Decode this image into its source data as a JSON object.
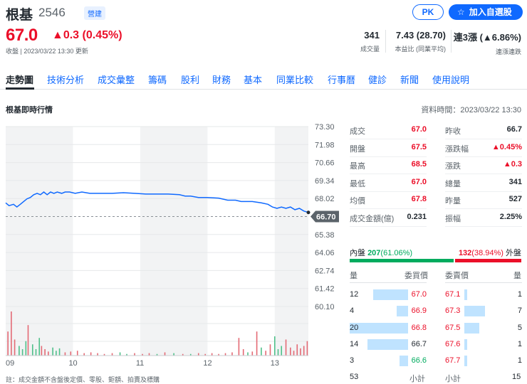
{
  "header": {
    "name": "根基",
    "code": "2546",
    "market_badge": "營建",
    "pk_label": "PK",
    "add_watchlist_label": "加入自選股",
    "price": "67.0",
    "change": "▲0.3 (0.45%)",
    "status_line": "收盤 | 2023/03/22 13:30 更新",
    "stats": [
      {
        "value": "341",
        "label": "成交量"
      },
      {
        "value": "7.43 (28.70)",
        "label": "本益比 (同業平均)"
      },
      {
        "value": "連3漲 (▲6.86%)",
        "label": "連漲連跌"
      }
    ]
  },
  "nav": {
    "tabs": [
      "走勢圖",
      "技術分析",
      "成交彙整",
      "籌碼",
      "股利",
      "財務",
      "基本",
      "同業比較",
      "行事曆",
      "健診",
      "新聞",
      "使用說明"
    ],
    "active_index": 0
  },
  "section": {
    "title": "根基即時行情",
    "data_time": "資料時間：2023/03/22 13:30"
  },
  "chart_data": {
    "type": "line",
    "x_labels": [
      "09",
      "10",
      "11",
      "12",
      "13"
    ],
    "y_ticks": [
      "73.30",
      "71.98",
      "70.66",
      "69.34",
      "68.02",
      "66.70",
      "65.38",
      "64.06",
      "62.74",
      "61.42",
      "60.10"
    ],
    "ylim": [
      60.1,
      73.3
    ],
    "reference_price": 66.7,
    "reference_label": "66.70",
    "x_range_minutes": [
      0,
      270
    ],
    "grid": true,
    "line_color": "#0f69ff",
    "price_series": [
      [
        0,
        67.7
      ],
      [
        3,
        67.5
      ],
      [
        7,
        67.6
      ],
      [
        10,
        67.4
      ],
      [
        13,
        67.6
      ],
      [
        16,
        67.8
      ],
      [
        19,
        68.0
      ],
      [
        22,
        68.1
      ],
      [
        25,
        68.3
      ],
      [
        28,
        68.4
      ],
      [
        31,
        68.3
      ],
      [
        34,
        68.5
      ],
      [
        37,
        68.3
      ],
      [
        40,
        68.5
      ],
      [
        43,
        68.4
      ],
      [
        46,
        68.5
      ],
      [
        50,
        68.4
      ],
      [
        53,
        68.5
      ],
      [
        57,
        68.5
      ],
      [
        62,
        68.4
      ],
      [
        68,
        68.5
      ],
      [
        75,
        68.4
      ],
      [
        85,
        68.4
      ],
      [
        95,
        68.4
      ],
      [
        105,
        68.45
      ],
      [
        115,
        68.4
      ],
      [
        125,
        68.35
      ],
      [
        135,
        68.35
      ],
      [
        145,
        68.35
      ],
      [
        155,
        68.3
      ],
      [
        160,
        68.2
      ],
      [
        165,
        68.2
      ],
      [
        172,
        68.1
      ],
      [
        180,
        68.1
      ],
      [
        190,
        68.05
      ],
      [
        198,
        67.9
      ],
      [
        205,
        67.9
      ],
      [
        210,
        67.8
      ],
      [
        220,
        67.8
      ],
      [
        228,
        67.7
      ],
      [
        234,
        67.6
      ],
      [
        238,
        67.4
      ],
      [
        242,
        67.3
      ],
      [
        246,
        67.4
      ],
      [
        250,
        67.3
      ],
      [
        254,
        67.4
      ],
      [
        258,
        67.2
      ],
      [
        262,
        67.3
      ],
      [
        266,
        67.1
      ],
      [
        270,
        67.0
      ]
    ],
    "volume_series": [
      [
        2,
        30
      ],
      [
        5,
        55
      ],
      [
        8,
        20
      ],
      [
        12,
        12
      ],
      [
        15,
        8
      ],
      [
        18,
        18
      ],
      [
        20,
        38
      ],
      [
        24,
        14
      ],
      [
        27,
        8
      ],
      [
        30,
        22
      ],
      [
        32,
        12
      ],
      [
        35,
        8
      ],
      [
        38,
        5
      ],
      [
        42,
        10
      ],
      [
        45,
        6
      ],
      [
        48,
        9
      ],
      [
        53,
        4
      ],
      [
        58,
        5
      ],
      [
        64,
        6
      ],
      [
        70,
        3
      ],
      [
        76,
        4
      ],
      [
        82,
        3
      ],
      [
        88,
        2
      ],
      [
        95,
        3
      ],
      [
        102,
        4
      ],
      [
        108,
        2
      ],
      [
        115,
        3
      ],
      [
        122,
        2
      ],
      [
        128,
        3
      ],
      [
        135,
        2
      ],
      [
        142,
        4
      ],
      [
        150,
        3
      ],
      [
        158,
        2
      ],
      [
        165,
        2
      ],
      [
        172,
        3
      ],
      [
        178,
        2
      ],
      [
        184,
        3
      ],
      [
        190,
        2
      ],
      [
        196,
        3
      ],
      [
        202,
        4
      ],
      [
        208,
        22
      ],
      [
        212,
        8
      ],
      [
        216,
        4
      ],
      [
        220,
        5
      ],
      [
        224,
        30
      ],
      [
        228,
        10
      ],
      [
        232,
        6
      ],
      [
        236,
        14
      ],
      [
        240,
        24
      ],
      [
        243,
        8
      ],
      [
        246,
        12
      ],
      [
        250,
        20
      ],
      [
        254,
        10
      ],
      [
        257,
        6
      ],
      [
        260,
        14
      ],
      [
        263,
        9
      ],
      [
        266,
        12
      ],
      [
        269,
        18
      ]
    ],
    "volume_colors": "red-up green-down"
  },
  "quote": {
    "left": [
      {
        "label": "成交",
        "value": "67.0",
        "color": "red"
      },
      {
        "label": "開盤",
        "value": "67.5",
        "color": "red"
      },
      {
        "label": "最高",
        "value": "68.5",
        "color": "red"
      },
      {
        "label": "最低",
        "value": "67.0",
        "color": "red"
      },
      {
        "label": "均價",
        "value": "67.8",
        "color": "red"
      },
      {
        "label": "成交金額(億)",
        "value": "0.231",
        "color": "dark"
      }
    ],
    "right": [
      {
        "label": "昨收",
        "value": "66.7",
        "color": "dark"
      },
      {
        "label": "漲跌幅",
        "value": "▲0.45%",
        "color": "red"
      },
      {
        "label": "漲跌",
        "value": "▲0.3",
        "color": "red"
      },
      {
        "label": "總量",
        "value": "341",
        "color": "dark"
      },
      {
        "label": "昨量",
        "value": "527",
        "color": "dark"
      },
      {
        "label": "振幅",
        "value": "2.25%",
        "color": "dark"
      }
    ]
  },
  "inner_outer": {
    "inner_label": "內盤",
    "inner_value": "207",
    "inner_pct": "(61.06%)",
    "outer_value": "132",
    "outer_pct": "(38.94%)",
    "outer_label": "外盤",
    "inner_fraction": 0.6106
  },
  "order_book": {
    "bid_header_qty": "量",
    "bid_header_price": "委買價",
    "ask_header_price": "委賣價",
    "ask_header_qty": "量",
    "bids": [
      {
        "qty": "12",
        "price": "67.0",
        "price_color": "red",
        "fraction": 0.6
      },
      {
        "qty": "4",
        "price": "66.9",
        "price_color": "red",
        "fraction": 0.2
      },
      {
        "qty": "20",
        "price": "66.8",
        "price_color": "red",
        "fraction": 1.0
      },
      {
        "qty": "14",
        "price": "66.7",
        "price_color": "dark",
        "fraction": 0.7
      },
      {
        "qty": "3",
        "price": "66.6",
        "price_color": "green",
        "fraction": 0.15
      }
    ],
    "asks": [
      {
        "price": "67.1",
        "qty": "1",
        "fraction": 0.07
      },
      {
        "price": "67.3",
        "qty": "7",
        "fraction": 0.5
      },
      {
        "price": "67.5",
        "qty": "5",
        "fraction": 0.36
      },
      {
        "price": "67.6",
        "qty": "1",
        "fraction": 0.07
      },
      {
        "price": "67.7",
        "qty": "1",
        "fraction": 0.07
      }
    ],
    "bid_total_value": "53",
    "bid_total_label": "小計",
    "ask_total_label": "小計",
    "ask_total_value": "15"
  },
  "footnote": "註：成交金額不含盤後定價、零股、鉅額、拍賣及標購"
}
